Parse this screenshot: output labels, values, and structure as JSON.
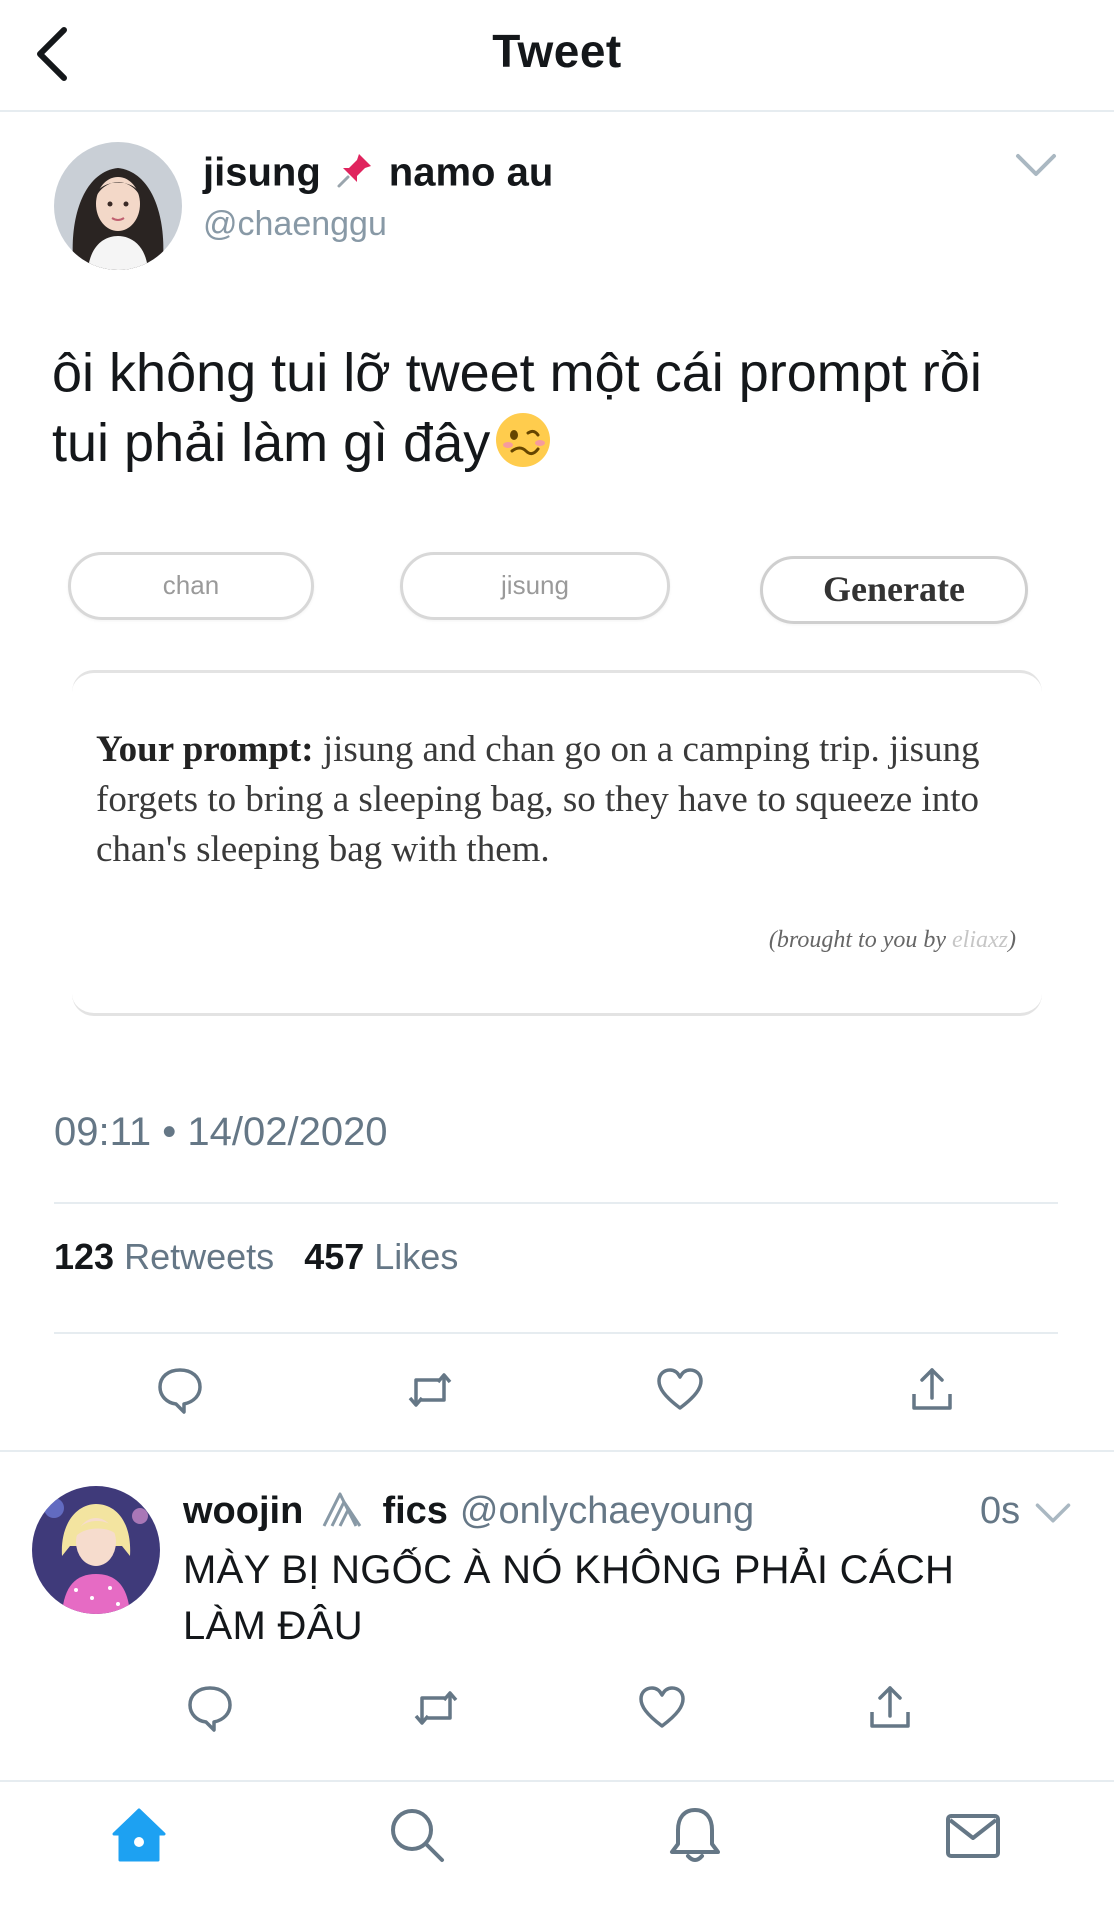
{
  "header": {
    "title": "Tweet"
  },
  "tweet": {
    "display_name_part1": "jisung",
    "display_name_part2": "namo au",
    "pin_icon": "pushpin-icon",
    "handle": "@chaenggu",
    "text_line1": "ôi không tui lỡ tweet một cái prompt rồi",
    "text_line2": "tui phải làm gì đây",
    "emoji": "woozy-face-icon",
    "timestamp": "09:11 • 14/02/2020",
    "retweets_count": "123",
    "retweets_label": "Retweets",
    "likes_count": "457",
    "likes_label": "Likes",
    "image": {
      "pill1": "chan",
      "pill2": "jisung",
      "generate": "Generate",
      "prompt_label": "Your prompt:",
      "prompt_body": "jisung and chan go on a camping trip. jisung forgets to bring a sleeping bag, so they have to squeeze into chan's sleeping bag with them.",
      "credit_prefix": "(brought to you by",
      "credit_name": "eliaxz",
      "credit_suffix": ")"
    }
  },
  "reply": {
    "display_name_part1": "woojin",
    "display_name_part2": "fics",
    "handle": "@onlychaeyoung",
    "time": "0s",
    "text": "MÀY BỊ NGỐC À NÓ KHÔNG PHẢI CÁCH LÀM ĐÂU"
  },
  "colors": {
    "accent": "#1da1f2",
    "secondary_text": "#657786",
    "divider": "#e6ecf0"
  }
}
